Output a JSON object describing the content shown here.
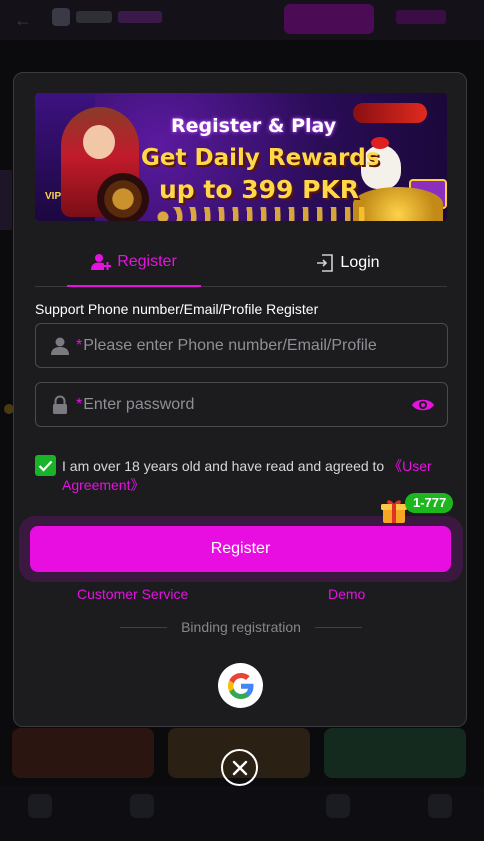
{
  "banner": {
    "line1": "Register & Play",
    "line2": "Get Daily Rewards",
    "line3": "up to 399 PKR",
    "vip": "VIP"
  },
  "tabs": [
    {
      "label": "Register",
      "icon": "user-add-icon",
      "active": true
    },
    {
      "label": "Login",
      "icon": "login-door-icon",
      "active": false
    }
  ],
  "form": {
    "support_text": "Support Phone number/Email/Profile Register",
    "required_mark": "*",
    "account_placeholder": "Please enter Phone number/Email/Profile",
    "account_value": "",
    "password_placeholder": "Enter password",
    "password_value": ""
  },
  "agreement": {
    "checked": true,
    "text": "I am over 18 years old and have read and agreed to ",
    "link": "《User Agreement》"
  },
  "promo_badge": "1-777",
  "register_button": "Register",
  "links": {
    "customer_service": "Customer Service",
    "demo": "Demo"
  },
  "binding_label": "Binding registration",
  "colors": {
    "accent": "#e512e0",
    "checkbox": "#19b32a",
    "badge": "#1eb61e",
    "modal_bg": "#1c1c1f"
  }
}
